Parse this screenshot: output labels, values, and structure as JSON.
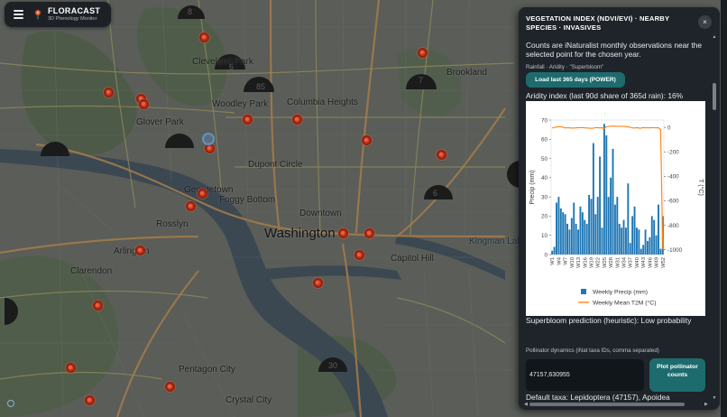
{
  "brand": {
    "title": "FLORACAST",
    "subtitle": "3D Phenology Monitor",
    "menu_icon": "hamburger-menu-icon",
    "logo_icon": "flower-logo-icon",
    "logo_color": "#e0553a"
  },
  "map": {
    "labels": [
      {
        "text": "Washington",
        "size": "big"
      },
      {
        "text": "Cleveland Park"
      },
      {
        "text": "Woodley Park"
      },
      {
        "text": "Glover Park"
      },
      {
        "text": "Columbia Heights"
      },
      {
        "text": "Brookland"
      },
      {
        "text": "Dupont Circle"
      },
      {
        "text": "Georgetown"
      },
      {
        "text": "Foggy Bottom"
      },
      {
        "text": "Downtown"
      },
      {
        "text": "Rosslyn"
      },
      {
        "text": "Arlington"
      },
      {
        "text": "Clarendon"
      },
      {
        "text": "Capitol Hill"
      },
      {
        "text": "Pentagon City"
      },
      {
        "text": "Crystal City"
      },
      {
        "text": "Kingman Lake"
      }
    ],
    "wedge_numbers": [
      "6",
      "85",
      "7",
      "8",
      "6",
      "30"
    ],
    "marker_color": "#c2361f",
    "attribution_icon": "leaflet-logo-icon",
    "attribution": "Leaflet"
  },
  "panel": {
    "title": "VEGETATION INDEX (NDVI/EVI) · NEARBY SPECIES · INVASIVES",
    "close_label": "×",
    "intro": "Counts are iNaturalist monthly observations near the selected point for the chosen year.",
    "section_label": "Rainfall · Aridity · \"Superbloom\"",
    "load_button": "Load last 365 days (POWER)",
    "aridity_text": "Aridity index (last 90d share of 365d rain): 16%",
    "superbloom_text": "Superbloom prediction (heuristic): Low probability",
    "pollinator_label": "Pollinator dynamics (iNat taxa IDs, comma separated)",
    "taxa_value": "47157,630955",
    "plot_button": "Plot pollinator counts",
    "default_taxa": "Default taxa: Lepidoptera (47157), Apoidea"
  },
  "chart_data": {
    "type": "bar",
    "title": "",
    "x": [
      "W1",
      "W2",
      "W3",
      "W4",
      "W5",
      "W6",
      "W7",
      "W8",
      "W9",
      "W10",
      "W11",
      "W12",
      "W13",
      "W14",
      "W15",
      "W16",
      "W17",
      "W18",
      "W19",
      "W20",
      "W21",
      "W22",
      "W23",
      "W24",
      "W25",
      "W26",
      "W27",
      "W28",
      "W29",
      "W30",
      "W31",
      "W32",
      "W33",
      "W34",
      "W35",
      "W36",
      "W37",
      "W38",
      "W39",
      "W40",
      "W41",
      "W42",
      "W43",
      "W44",
      "W45",
      "W46",
      "W47",
      "W48",
      "W49",
      "W50",
      "W51",
      "W52"
    ],
    "xtick_labels": [
      "W1",
      "W4",
      "W7",
      "W10",
      "W13",
      "W16",
      "W19",
      "W22",
      "W25",
      "W28",
      "W31",
      "W34",
      "W37",
      "W40",
      "W43",
      "W46",
      "W49",
      "W52"
    ],
    "series": [
      {
        "name": "Weekly Precip (mm)",
        "axis": "left",
        "color": "#1f77b4",
        "values": [
          2,
          4,
          27,
          30,
          24,
          22,
          21,
          16,
          13,
          19,
          27,
          16,
          13,
          25,
          22,
          18,
          16,
          31,
          29,
          58,
          21,
          30,
          51,
          14,
          68,
          62,
          30,
          40,
          55,
          26,
          30,
          16,
          14,
          18,
          14,
          37,
          6,
          20,
          25,
          14,
          13,
          3,
          5,
          13,
          7,
          9,
          20,
          18,
          10,
          26,
          3,
          20
        ]
      },
      {
        "name": "Weekly Mean T2M (°C)",
        "axis": "right",
        "color": "#ff7f0e",
        "values": [
          -5,
          0,
          3,
          5,
          5,
          2,
          -5,
          -3,
          -4,
          -6,
          -5,
          -4,
          -2,
          -3,
          -1,
          -4,
          -5,
          -6,
          -8,
          -6,
          -3,
          -2,
          -5,
          -3,
          -10,
          5,
          8,
          10,
          10,
          10,
          8,
          9,
          8,
          9,
          6,
          3,
          2,
          -4,
          -5,
          -2,
          -6,
          -6,
          -1,
          -4,
          -3,
          -4,
          -2,
          -3,
          -4,
          -3,
          -20,
          -999
        ]
      }
    ],
    "ylabel": "Precip (mm)",
    "y2label": "T (°C)",
    "ylim": [
      0,
      70
    ],
    "y2lim": [
      -1040,
      60
    ],
    "yticks": [
      0,
      10,
      20,
      30,
      40,
      50,
      60,
      70
    ],
    "y2ticks": [
      0,
      -200,
      -400,
      -600,
      -800,
      -1000
    ],
    "legend": "bottom",
    "grid": false
  }
}
